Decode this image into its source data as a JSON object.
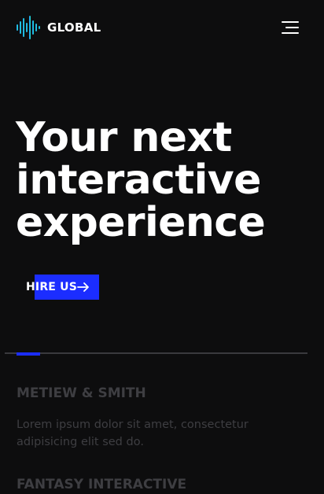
{
  "header": {
    "logo_text": "GLOBAL",
    "logo_icon": "audio-wave-icon",
    "menu_icon": "hamburger-menu-icon"
  },
  "hero": {
    "title": "Your next\ninteractive\nexperience",
    "cta_label": "HIRE US",
    "cta_icon": "arrow-right-icon"
  },
  "slider": {
    "progress": 0.08
  },
  "entries": [
    {
      "title": "METIEW & SMITH",
      "text": "Lorem ipsum dolor sit amet, consectetur adipisicing elit sed do."
    },
    {
      "title": "FANTASY INTERACTIVE",
      "text": ""
    }
  ],
  "colors": {
    "background": "#0d0d0e",
    "accent": "#1b2dff",
    "logo_gradient_start": "#1f8fff",
    "logo_gradient_end": "#21e6c1",
    "muted_text": "#3e3e42"
  }
}
